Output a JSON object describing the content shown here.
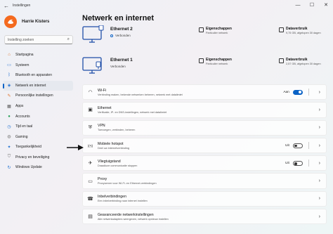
{
  "window": {
    "title": "Instellingen",
    "back_icon": "back-arrow-icon",
    "controls": [
      "minimize-icon",
      "maximize-icon",
      "close-icon"
    ]
  },
  "sidebar": {
    "user_name": "Harrie Kisters",
    "search_placeholder": "Instelling zoeken",
    "items": [
      {
        "label": "Startpagina",
        "icon": "home-icon",
        "color": "#e0732a"
      },
      {
        "label": "Systeem",
        "icon": "monitor-icon",
        "color": "#1f6fd1"
      },
      {
        "label": "Bluetooth en apparaten",
        "icon": "bluetooth-icon",
        "color": "#1f6fd1"
      },
      {
        "label": "Netwerk en internet",
        "icon": "network-icon",
        "color": "#1f6fd1",
        "active": true
      },
      {
        "label": "Persoonlijke instellingen",
        "icon": "brush-icon",
        "color": "#e0732a"
      },
      {
        "label": "Apps",
        "icon": "apps-icon",
        "color": "#555555"
      },
      {
        "label": "Accounts",
        "icon": "account-icon",
        "color": "#2aa05a"
      },
      {
        "label": "Tijd en taal",
        "icon": "globe-clock-icon",
        "color": "#1f6fd1"
      },
      {
        "label": "Gaming",
        "icon": "gamepad-icon",
        "color": "#777777"
      },
      {
        "label": "Toegankelijkheid",
        "icon": "accessibility-icon",
        "color": "#1f6fd1"
      },
      {
        "label": "Privacy en beveiliging",
        "icon": "shield-icon",
        "color": "#666666"
      },
      {
        "label": "Windows Update",
        "icon": "update-icon",
        "color": "#1f6fd1"
      }
    ]
  },
  "main": {
    "title": "Netwerk en internet",
    "ethernet_blocks": [
      {
        "name": "Ethernet 2",
        "status": "Verbonden",
        "properties_title": "Eigenschappen",
        "properties_sub": "Particulier netwerk",
        "usage_title": "Dataverbruik",
        "usage_sub": "9,75 GB, afgelopen 30 dagen"
      },
      {
        "name": "Ethernet 1",
        "status": "Verbonden",
        "properties_title": "Eigenschappen",
        "properties_sub": "Particulier netwerk",
        "usage_title": "Dataverbruik",
        "usage_sub": "2,57 GB, afgelopen 30 dagen"
      }
    ],
    "cards": [
      {
        "title": "Wi-Fi",
        "sub": "Verbinding maken, bekende netwerken beheren, netwerk met datalimiet",
        "icon": "wifi-icon",
        "toggle": "on",
        "toggle_label": "Aan",
        "chevron": true
      },
      {
        "title": "Ethernet",
        "sub": "Verificatie, IP- en DNS-instellingen, netwerk met datalimiet",
        "icon": "ethernet-icon",
        "chevron": true
      },
      {
        "title": "VPN",
        "sub": "Toevoegen, verbinden, beheren",
        "icon": "vpn-icon",
        "chevron": true
      },
      {
        "title": "Mobiele hotspot",
        "sub": "Deel uw internetverbinding",
        "icon": "hotspot-icon",
        "toggle": "off",
        "toggle_label": "Uit",
        "chevron": true
      },
      {
        "title": "Vliegtuigstand",
        "sub": "Draadloze communicatie stoppen",
        "icon": "airplane-icon",
        "toggle": "off",
        "toggle_label": "Uit",
        "chevron": true
      },
      {
        "title": "Proxy",
        "sub": "Proxyserver voor Wi-Fi- en Ethernet-verbindingen",
        "icon": "proxy-icon",
        "chevron": true
      },
      {
        "title": "Inbelverbindingen",
        "sub": "Een inbelverbinding naar internet instellen",
        "icon": "dialup-icon",
        "chevron": true
      },
      {
        "title": "Geavanceerde netwerkinstellingen",
        "sub": "Alle netwerkadapters weergeven, netwerk opnieuw instellen",
        "icon": "network-settings-icon",
        "chevron": true
      }
    ],
    "annotation_icon": "pointer-arrow-icon"
  },
  "colors": {
    "accent": "#0a62c5",
    "avatar": "#f46a1f"
  }
}
